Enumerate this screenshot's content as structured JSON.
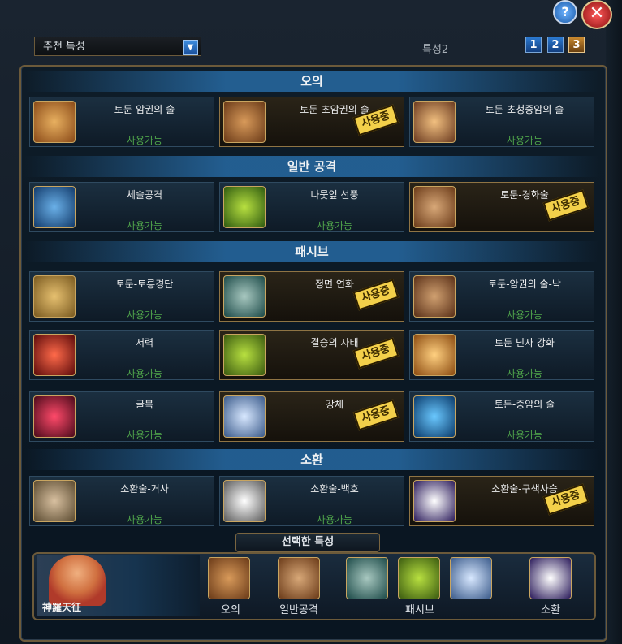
{
  "header": {
    "help_label": "?",
    "close_label": "✕",
    "dropdown_value": "추천 특성",
    "preset_label": "특성2",
    "presets": [
      "1",
      "2",
      "3"
    ]
  },
  "sections": {
    "ougi": "오의",
    "normal": "일반 공격",
    "passive": "패시브",
    "summon": "소환"
  },
  "cards": [
    {
      "name": "토둔-암권의 술",
      "status": "사용가능",
      "active": false
    },
    {
      "name": "토둔-초암권의 술",
      "status": "사용중",
      "active": true
    },
    {
      "name": "토둔-초청중암의 술",
      "status": "사용가능",
      "active": false
    },
    {
      "name": "체술공격",
      "status": "사용가능",
      "active": false
    },
    {
      "name": "나뭇잎 선풍",
      "status": "사용가능",
      "active": false
    },
    {
      "name": "토둔-경화술",
      "status": "사용중",
      "active": true
    },
    {
      "name": "토둔-토릉경단",
      "status": "사용가능",
      "active": false
    },
    {
      "name": "정면 연화",
      "status": "사용중",
      "active": true
    },
    {
      "name": "토둔-암권의 술-낙",
      "status": "사용가능",
      "active": false
    },
    {
      "name": "저력",
      "status": "사용가능",
      "active": false
    },
    {
      "name": "결승의 자태",
      "status": "사용중",
      "active": true
    },
    {
      "name": "토둔 닌자 강화",
      "status": "사용가능",
      "active": false
    },
    {
      "name": "굴복",
      "status": "사용가능",
      "active": false
    },
    {
      "name": "강체",
      "status": "사용중",
      "active": true
    },
    {
      "name": "토둔-중암의 술",
      "status": "사용가능",
      "active": false
    },
    {
      "name": "소환술-거사",
      "status": "사용가능",
      "active": false
    },
    {
      "name": "소환술-백호",
      "status": "사용가능",
      "active": false
    },
    {
      "name": "소환술-구색사슴",
      "status": "사용중",
      "active": true
    }
  ],
  "selected": {
    "title": "선택한 특성",
    "character_name": "神羅天征",
    "labels": {
      "ougi": "오의",
      "normal": "일반공격",
      "passive": "패시브",
      "summon": "소환"
    }
  }
}
